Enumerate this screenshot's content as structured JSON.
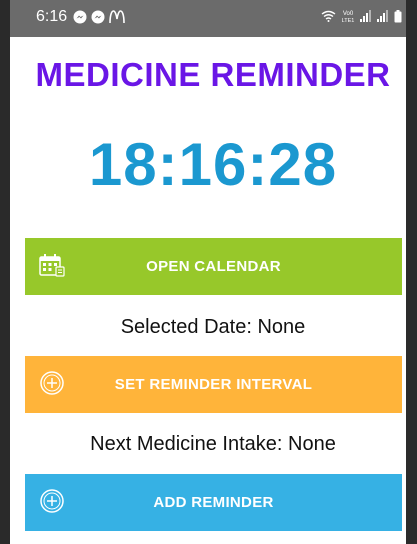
{
  "status_bar": {
    "time": "6:16",
    "left_icons": [
      "messenger-icon",
      "messenger-icon",
      "mcdonalds-icon"
    ],
    "right_icons": [
      "wifi-icon",
      "volte-icon",
      "signal-icon",
      "signal-icon",
      "battery-icon"
    ],
    "volte_label": "Vo0\nLTE1",
    "background_color": "#6b6b6b"
  },
  "app": {
    "title": "MEDICINE REMINDER",
    "title_color": "#6a16e6",
    "clock": "18:16:28",
    "clock_color": "#1b98d0"
  },
  "buttons": {
    "open_calendar": {
      "label": "OPEN CALENDAR",
      "icon": "calendar-icon",
      "color": "#97c82a"
    },
    "set_interval": {
      "label": "SET REMINDER INTERVAL",
      "icon": "add-circle-icon",
      "color": "#ffb43a"
    },
    "add_reminder": {
      "label": "ADD REMINDER",
      "icon": "add-circle-icon",
      "color": "#36b1e4"
    }
  },
  "info": {
    "selected_date": "Selected Date: None",
    "next_intake": "Next Medicine Intake: None"
  }
}
